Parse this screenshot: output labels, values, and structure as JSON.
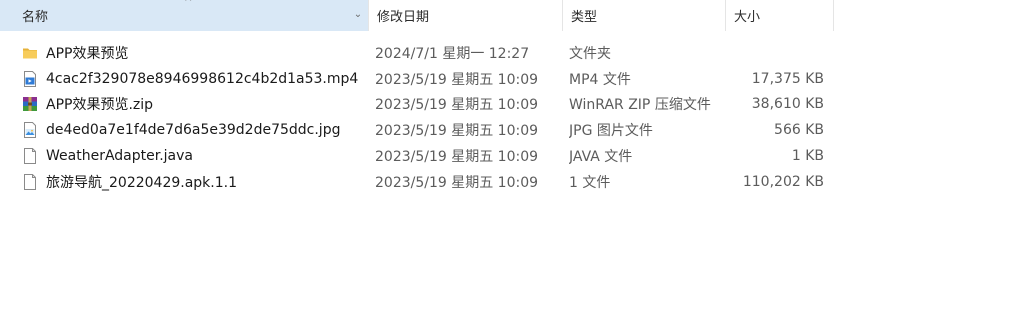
{
  "header": {
    "name": "名称",
    "date": "修改日期",
    "type": "类型",
    "size": "大小",
    "sort_glyph": "^",
    "chevron_glyph": "⌄"
  },
  "rows": [
    {
      "name": "APP效果预览",
      "date": "2024/7/1 星期一 12:27",
      "type": "文件夹",
      "size": "",
      "icon": "folder-icon"
    },
    {
      "name": "4cac2f329078e8946998612c4b2d1a53.mp4",
      "date": "2023/5/19 星期五 10:09",
      "type": "MP4 文件",
      "size": "17,375 KB",
      "icon": "video-file-icon"
    },
    {
      "name": "APP效果预览.zip",
      "date": "2023/5/19 星期五 10:09",
      "type": "WinRAR ZIP 压缩文件",
      "size": "38,610 KB",
      "icon": "winrar-archive-icon"
    },
    {
      "name": "de4ed0a7e1f4de7d6a5e39d2de75ddc.jpg",
      "date": "2023/5/19 星期五 10:09",
      "type": "JPG 图片文件",
      "size": "566 KB",
      "icon": "image-file-icon"
    },
    {
      "name": "WeatherAdapter.java",
      "date": "2023/5/19 星期五 10:09",
      "type": "JAVA 文件",
      "size": "1 KB",
      "icon": "blank-file-icon"
    },
    {
      "name": "旅游导航_20220429.apk.1.1",
      "date": "2023/5/19 星期五 10:09",
      "type": "1 文件",
      "size": "110,202 KB",
      "icon": "blank-file-icon"
    }
  ]
}
